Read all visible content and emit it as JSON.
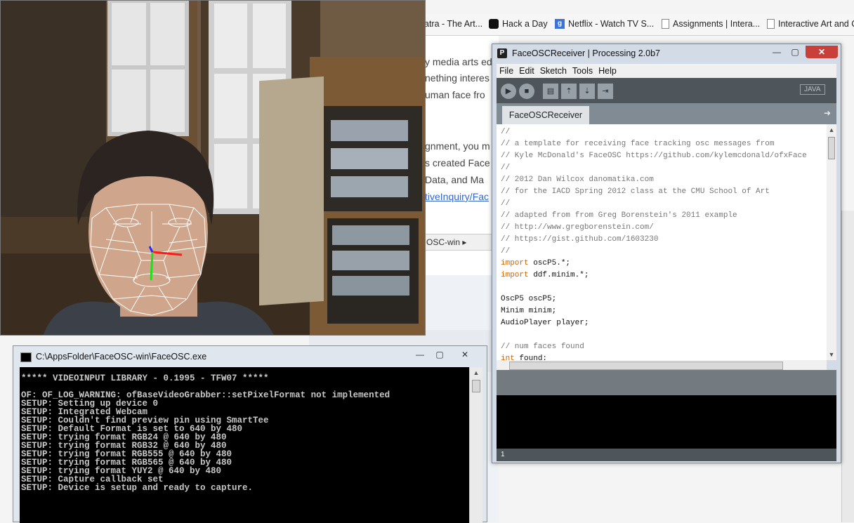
{
  "browser": {
    "bookmarks": [
      {
        "label": "atra - The Art...",
        "icon": "none"
      },
      {
        "label": "Hack a Day",
        "icon": "skull-icon"
      },
      {
        "label": "Netflix - Watch TV S...",
        "icon": "google-icon"
      },
      {
        "label": "Assignments | Intera...",
        "icon": "page-icon"
      },
      {
        "label": "Interactive Art and C",
        "icon": "page-icon"
      }
    ],
    "page_lines": [
      "y media arts ed",
      "nething interes",
      "uman face fro",
      "gnment, you m",
      "s created Face",
      "Data, and Ma",
      "tiveInquiry/Fac"
    ],
    "explorer_path": "OSC-win"
  },
  "console": {
    "title": "C:\\AppsFolder\\FaceOSC-win\\FaceOSC.exe",
    "lines": [
      "***** VIDEOINPUT LIBRARY - 0.1995 - TFW07 *****",
      "",
      "OF: OF_LOG_WARNING: ofBaseVideoGrabber::setPixelFormat not implemented",
      "SETUP: Setting up device 0",
      "SETUP: Integrated Webcam",
      "SETUP: Couldn't find preview pin using SmartTee",
      "SETUP: Default Format is set to 640 by 480",
      "SETUP: trying format RGB24 @ 640 by 480",
      "SETUP: trying format RGB32 @ 640 by 480",
      "SETUP: trying format RGB555 @ 640 by 480",
      "SETUP: trying format RGB565 @ 640 by 480",
      "SETUP: trying format YUY2 @ 640 by 480",
      "SETUP: Capture callback set",
      "SETUP: Device is setup and ready to capture."
    ]
  },
  "processing": {
    "title": "FaceOSCReceiver | Processing 2.0b7",
    "menu": [
      "File",
      "Edit",
      "Sketch",
      "Tools",
      "Help"
    ],
    "mode_label": "JAVA",
    "tab_label": "FaceOSCReceiver",
    "line_number": "1",
    "code": [
      "//",
      "// a template for receiving face tracking osc messages from",
      "// Kyle McDonald's FaceOSC https://github.com/kylemcdonald/ofxFace",
      "//",
      "// 2012 Dan Wilcox danomatika.com",
      "// for the IACD Spring 2012 class at the CMU School of Art",
      "//",
      "// adapted from from Greg Borenstein's 2011 example",
      "// http://www.gregborenstein.com/",
      "// https://gist.github.com/1603230",
      "//",
      "import oscP5.*;",
      "import ddf.minim.*;",
      "",
      "OscP5 oscP5;",
      "Minim minim;",
      "AudioPlayer player;",
      "",
      "// num faces found",
      "int found;"
    ]
  },
  "colors": {
    "processing_toolbar": "#4e565c",
    "processing_tabbar": "#818b93",
    "close_button": "#c7413a",
    "keyword": "#cc6600",
    "comment": "#777777",
    "face_mesh": "#ffffff"
  }
}
